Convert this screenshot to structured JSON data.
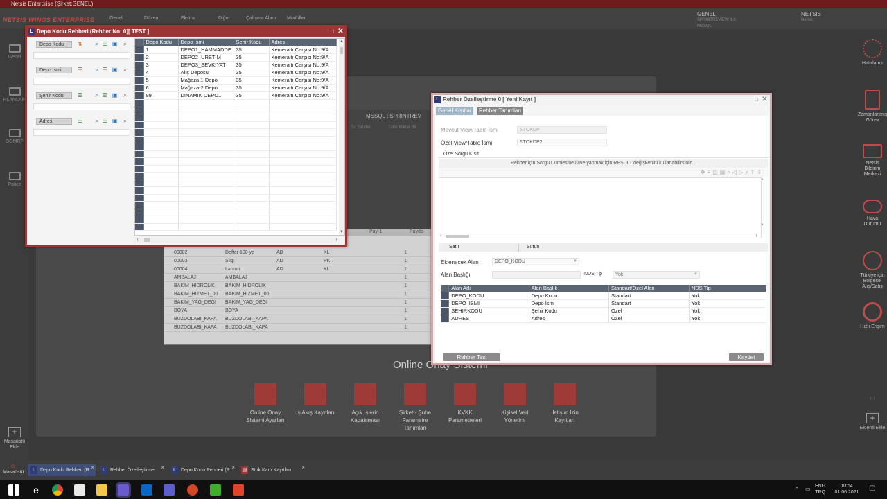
{
  "app": {
    "title": "Netsis Enterprise (Şirket:GENEL)",
    "logo": "NETSİS WINGS ENTERPRISE",
    "menu": [
      "Genel",
      "Düzen",
      "Ekstra",
      "Diğer",
      "Çalışma Alanı",
      "Modüller"
    ],
    "company": {
      "name": "GENEL",
      "line1": "SPRINTREVIEW 1.0",
      "line2": "MSSQL"
    },
    "product": {
      "name": "NETSIS",
      "sub": "Netsis"
    }
  },
  "left_nav": [
    {
      "label": "Genel",
      "icon": "monitor-icon"
    },
    {
      "label": "PLANLAM",
      "icon": "monitor-icon"
    },
    {
      "label": "DOMRF",
      "icon": "monitor-icon"
    },
    {
      "label": "Poliçe",
      "icon": "monitor-icon"
    },
    {
      "label": "Masaüstü Ekle",
      "icon": "plus-icon"
    }
  ],
  "right_nav": [
    {
      "label": "Hatırlatıcı",
      "icon": "gear-icon"
    },
    {
      "label": "Zamanlanmış Görev",
      "icon": "clipboard-icon"
    },
    {
      "label": "Netsis Bildirim Merkezi",
      "icon": "mail-icon"
    },
    {
      "label": "Hava Durumu",
      "icon": "cloud-icon"
    },
    {
      "label": "Türkiye için Bölgesel Alış/Satış",
      "icon": "chart-icon"
    },
    {
      "label": "Hızlı Erişim",
      "icon": "target-icon"
    },
    {
      "label": "Eklenti Ekle",
      "icon": "plus-icon"
    }
  ],
  "background": {
    "section_title": "Online Onay Sistemi",
    "toolbar_text": "MSSQL | SPRINTREV",
    "tabs": [
      "Tst.Satırlar",
      "Tutar Miktar Bil"
    ],
    "grid_headers": [
      "Pay-1",
      "Payda-"
    ],
    "grid_rows": [
      [
        "00002",
        "Defter 100 yp",
        "AD",
        "KL",
        "1"
      ],
      [
        "00003",
        "Silgi",
        "AD",
        "PK",
        "1"
      ],
      [
        "00004",
        "Laptop",
        "AD",
        "KL",
        "1"
      ],
      [
        "AMBALAJ",
        "AMBALAJ",
        "",
        "",
        "1"
      ],
      [
        "BAKIM_HIDROLIK_",
        "BAKIM_HIDROLIK_",
        "",
        "",
        "1"
      ],
      [
        "BAKIM_HIZMET_00",
        "BAKIM_HIZMET_00",
        "",
        "",
        "1"
      ],
      [
        "BAKIM_YAG_DEGI",
        "BAKIM_YAG_DEGI",
        "",
        "",
        "1"
      ],
      [
        "BOYA",
        "BOYA",
        "",
        "",
        "1"
      ],
      [
        "BUZDOLABI_KAPA",
        "BUZDOLABI_KAPA",
        "",
        "",
        "1"
      ],
      [
        "BUZDOLABI_KAPA",
        "BUZDOLABI_KAPA",
        "",
        "",
        "1"
      ]
    ],
    "icons": [
      {
        "label": "Online Onay Sistemi Ayarları"
      },
      {
        "label": "İş Akış Kayıtları"
      },
      {
        "label": "Açık İşlerin Kapatılması"
      },
      {
        "label": "Şirket - Şube Parametre Tanımları"
      },
      {
        "label": "KVKK Parametreleri"
      },
      {
        "label": "Kişisel Veri Yönetimi"
      },
      {
        "label": "İletişim İzin Kayıtları"
      }
    ]
  },
  "depo_window": {
    "title": "Depo Kodu Rehberi (Rehber No: 0)[ TEST ]",
    "filters": [
      "Depo Kodu",
      "Depo İsmi",
      "Şehir Kodu",
      "Adres"
    ],
    "columns": [
      "Depo Kodu",
      "Depo İsmi",
      "Şehir Kodu",
      "Adres"
    ],
    "rows": [
      [
        "1",
        "DEPO1_HAMMADDE",
        "35",
        "Kemeraltı Çarşısı No:9/A"
      ],
      [
        "2",
        "DEPO2_URETIM",
        "35",
        "Kemeraltı Çarşısı No:9/A"
      ],
      [
        "3",
        "DEPO3_SEVKIYAT",
        "35",
        "Kemeraltı Çarşısı No:9/A"
      ],
      [
        "4",
        "Alış Deposu",
        "35",
        "Kemeraltı Çarşısı No:9/A"
      ],
      [
        "5",
        "Mağaza 1-Depo",
        "35",
        "Kemeraltı Çarşısı No:9/A"
      ],
      [
        "6",
        "Mağaza-2 Depo",
        "35",
        "Kemeraltı Çarşısı No:9/A"
      ],
      [
        "99",
        "DINAMIK DEPO1",
        "35",
        "Kemeraltı Çarşısı No:9/A"
      ]
    ]
  },
  "rehber_window": {
    "title": "Rehber Özelleştirme 0 [ Yeni Kayıt ]",
    "tabs": [
      "Genel Kısıtlar",
      "Rehber Tanımları"
    ],
    "mevcut_label": "Mevcut View/Tablo İsmi",
    "mevcut_value": "STOKDP",
    "ozel_label": "Özel View/Tablo İsmi",
    "ozel_value": "STOKDP2",
    "sorgu_label": "Özel Sorgu Kısıt",
    "sorgu_hint": "Rehber için Sorgu Cümlesine ilave yapmak için  RESULT değişkenini kullanabilirsiniz...",
    "status": [
      "Satır",
      "Sütun"
    ],
    "eklenecek_label": "Eklenecek Alan",
    "eklenecek_value": "DEPO_KODU",
    "baslik_label": "Alan Başlığı",
    "baslik_value": "",
    "nds_label": "NDS Tip",
    "nds_value": "Yok",
    "table_columns": [
      "Alan Adı",
      "Alan Başlık",
      "Standart/Özel Alan",
      "NDS Tip"
    ],
    "table_rows": [
      [
        "DEPO_KODU",
        "Depo Kodu",
        "Standart",
        "Yok"
      ],
      [
        "DEPO_ISMI",
        "Depo İsmi",
        "Standart",
        "Yok"
      ],
      [
        "SEHIRKODU",
        "Şehir Kodu",
        "Özel",
        "Yok"
      ],
      [
        "ADRES",
        "Adres",
        "Özel",
        "Yok"
      ]
    ],
    "test_button": "Rehber Test",
    "save_button": "Kaydet"
  },
  "app_taskbar": {
    "home": "Masaüstü",
    "tabs": [
      "Depo Kodu Rehberi (R",
      "Rehber Özelleştirme",
      "Depo Kodu Rehberi (R",
      "Stok Kartı Kayıtları"
    ]
  },
  "system_tray": {
    "lang1": "ENG",
    "lang2": "TRQ",
    "time": "10:54",
    "date": "01.06.2021"
  },
  "colors": {
    "accent": "#9c3535",
    "window_bg": "#f4f4f4",
    "grid_header": "#5a6472"
  }
}
